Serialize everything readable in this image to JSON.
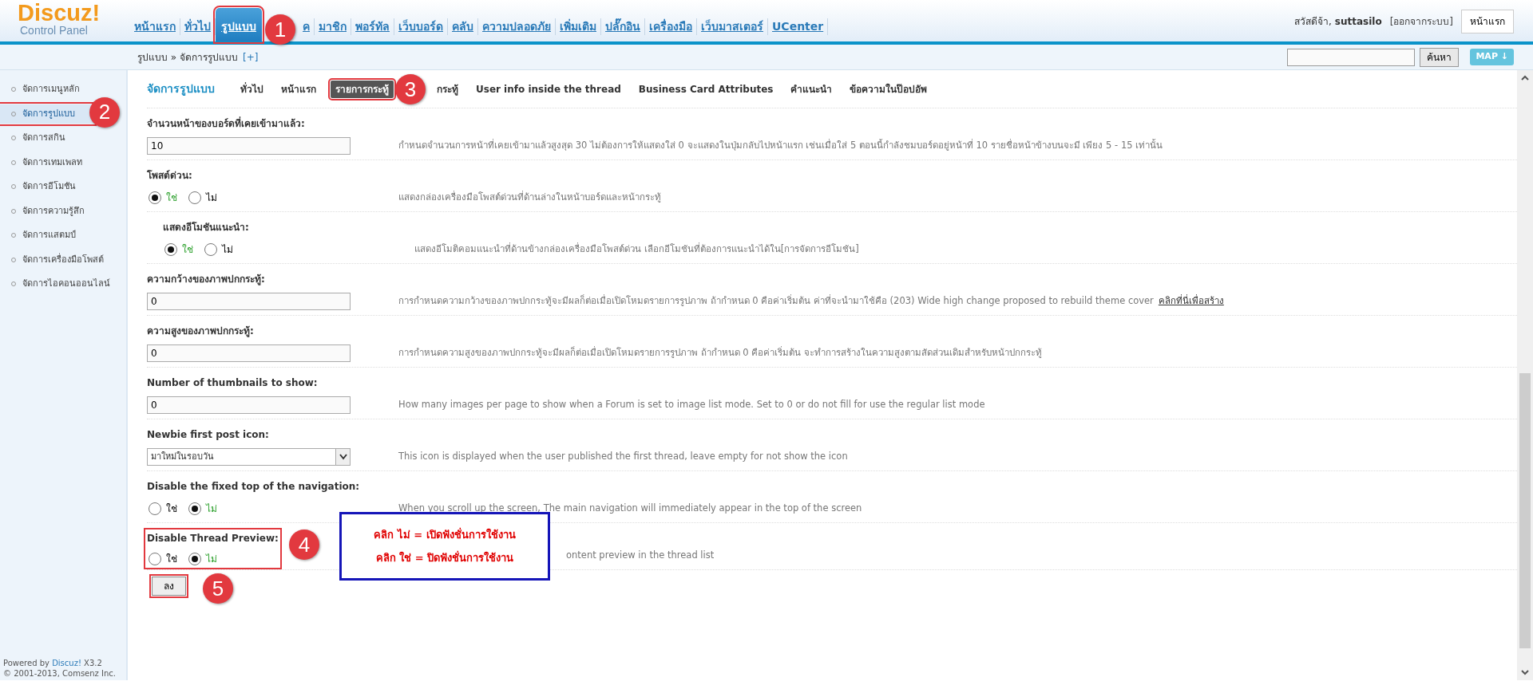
{
  "logo": {
    "name": "Discuz!",
    "subtitle": "Control Panel"
  },
  "nav": [
    {
      "label": "หน้าแรก",
      "selected": false
    },
    {
      "label": "ทั่วไป",
      "selected": false
    },
    {
      "label": "รูปแบบ",
      "selected": true,
      "marked": true,
      "annotation": "1"
    },
    {
      "label": "ค",
      "selected": false
    },
    {
      "label": "มาชิก",
      "selected": false
    },
    {
      "label": "พอร์ทัล",
      "selected": false
    },
    {
      "label": "เว็บบอร์ด",
      "selected": false
    },
    {
      "label": "คลับ",
      "selected": false
    },
    {
      "label": "ความปลอดภัย",
      "selected": false
    },
    {
      "label": "เพิ่มเติม",
      "selected": false
    },
    {
      "label": "ปลั๊กอิน",
      "selected": false
    },
    {
      "label": "เครื่องมือ",
      "selected": false
    },
    {
      "label": "เว็บมาสเตอร์",
      "selected": false
    },
    {
      "label": "UCenter",
      "selected": false
    }
  ],
  "user": {
    "greeting": "สวัสดีจ้า,",
    "username": "suttasilo",
    "logout": "[ออกจากระบบ]",
    "home_button": "หน้าแรก"
  },
  "breadcrumb": {
    "path": "รูปแบบ » จัดการรูปแบบ",
    "add": "[+]"
  },
  "search": {
    "button": "ค้นหา",
    "map_button": "MAP ↓"
  },
  "sidebar": {
    "items": [
      {
        "label": "จัดการเมนูหลัก",
        "selected": false
      },
      {
        "label": "จัดการรูปแบบ",
        "selected": true,
        "marked": true,
        "annotation": "2"
      },
      {
        "label": "จัดการสกิน",
        "selected": false
      },
      {
        "label": "จัดการเทมเพลท",
        "selected": false
      },
      {
        "label": "จัดการอีโมชัน",
        "selected": false
      },
      {
        "label": "จัดการความรู้สึก",
        "selected": false
      },
      {
        "label": "จัดการแสตมป์",
        "selected": false
      },
      {
        "label": "จัดการเครื่องมือโพสต์",
        "selected": false
      },
      {
        "label": "จัดการไอคอนออนไลน์",
        "selected": false
      }
    ]
  },
  "footer": {
    "powered": "Powered by",
    "brand": "Discuz!",
    "version": "X3.2",
    "copyright": "© 2001-2013, Comsenz Inc."
  },
  "page_title": "จัดการรูปแบบ",
  "tabs": [
    {
      "label": "ทั่วไป",
      "selected": false
    },
    {
      "label": "หน้าแรก",
      "selected": false
    },
    {
      "label": "รายการกระทู้",
      "selected": true,
      "marked": true,
      "annotation": "3"
    },
    {
      "label": "กระทู้",
      "selected": false
    },
    {
      "label": "User info inside the thread",
      "selected": false
    },
    {
      "label": "Business Card Attributes",
      "selected": false
    },
    {
      "label": "คำแนะนำ",
      "selected": false
    },
    {
      "label": "ข้อความในป๊อปอัพ",
      "selected": false
    }
  ],
  "settings": [
    {
      "kind": "text",
      "label": "จำนวนหน้าของบอร์ดที่เคยเข้ามาแล้ว:",
      "value": "10",
      "description": "กำหนดจำนวนการหน้าที่เคยเข้ามาแล้วสูงสุด 30 ไม่ต้องการให้แสดงใส่ 0 จะแสดงในปุ่มกลับไปหน้าแรก เช่นเมื่อใส่ 5 ตอนนี้กำลังชมบอร์ดอยู่หน้าที่ 10 รายชื่อหน้าข้างบนจะมี เพียง 5 - 15 เท่านั้น"
    },
    {
      "kind": "radio",
      "label": "โพสต์ด่วน:",
      "options": [
        {
          "label": "ใช่",
          "selected": true
        },
        {
          "label": "ไม่",
          "selected": false
        }
      ],
      "description": "แสดงกล่องเครื่องมือโพสต์ด่วนที่ด้านล่างในหน้าบอร์ดและหน้ากระทู้"
    },
    {
      "kind": "radio",
      "sub": true,
      "label": "แสดงอีโมชันแนะนำ:",
      "options": [
        {
          "label": "ใช่",
          "selected": true
        },
        {
          "label": "ไม่",
          "selected": false
        }
      ],
      "description": "แสดงอีโมติคอมแนะนำที่ด้านข้างกล่องเครื่องมือโพสต์ด่วน เลือกอีโมชันที่ต้องการแนะนำได้ใน[การจัดการอีโมชัน]"
    },
    {
      "kind": "text",
      "label": "ความกว้างของภาพปกกระทู้:",
      "value": "0",
      "description": "การกำหนดความกว้างของภาพปกกระทู้จะมีผลก็ต่อเมื่อเปิดโหมดรายการรูปภาพ ถ้ากำหนด 0 คือค่าเริ่มต้น ค่าที่จะนำมาใช้คือ (203) Wide high change proposed to rebuild theme cover",
      "link": "คลิกที่นี่เพื่อสร้าง"
    },
    {
      "kind": "text",
      "label": "ความสูงของภาพปกกระทู้:",
      "value": "0",
      "description": "การกำหนดความสูงของภาพปกกระทู้จะมีผลก็ต่อเมื่อเปิดโหมดรายการรูปภาพ ถ้ากำหนด 0 คือค่าเริ่มต้น จะทำการสร้างในความสูงตามสัดส่วนเดิมสำหรับหน้าปกกระทู้"
    },
    {
      "kind": "text",
      "label": "Number of thumbnails to show:",
      "value": "0",
      "description": "How many images per page to show when a Forum is set to image list mode. Set to 0 or do not fill for use the regular list mode"
    },
    {
      "kind": "select",
      "label": "Newbie first post icon:",
      "value": "มาใหม่ในรอบวัน",
      "description": "This icon is displayed when the user published the first thread, leave empty for not show the icon"
    },
    {
      "kind": "radio",
      "label": "Disable the fixed top of the navigation:",
      "options": [
        {
          "label": "ใช่",
          "selected": false
        },
        {
          "label": "ไม่",
          "selected": true
        }
      ],
      "description": "When you scroll up the screen, The main navigation will immediately appear in the top of the screen"
    },
    {
      "kind": "radio",
      "label": "Disable Thread Preview:",
      "marked": true,
      "annotation": "4",
      "options": [
        {
          "label": "ใช่",
          "selected": false
        },
        {
          "label": "ไม่",
          "selected": true
        }
      ],
      "description": "ontent preview in the thread list",
      "callout": [
        "คลิก ไม่ = เปิดฟังชั่นการใช้งาน",
        "คลิก ใช่ = ปิดฟังชั่นการใช้งาน"
      ]
    }
  ],
  "submit": {
    "label": "ลง",
    "marked": true,
    "annotation": "5"
  }
}
